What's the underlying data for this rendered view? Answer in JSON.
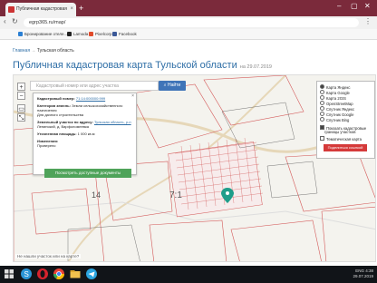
{
  "browser": {
    "tab_title": "Публичная кадастровая",
    "tab_close": "×",
    "new_tab": "+",
    "window_controls": [
      "–",
      "▢",
      "✕"
    ],
    "url": "egrp365.ru/map/",
    "bookmarks": [
      "Бронирование отеле...",
      "Lamoda",
      "Pixelcorp",
      "Facebook"
    ]
  },
  "page": {
    "breadcrumb_home": "Главная",
    "breadcrumb_sep": "→",
    "breadcrumb_current": "Тульская область",
    "title": "Публичная кадастровая карта Тульской области",
    "title_date": "на 29.07.2019"
  },
  "map": {
    "search_placeholder": "Кадастровый номер или адрес участка",
    "find_button": "Найти",
    "tools": [
      "+",
      "−",
      "▭",
      "⤡"
    ],
    "popup": {
      "close": "×",
      "cadastral_label": "Кадастровый номер:",
      "cadastral_value": "71:14:000000:999",
      "category_label": "Категория земель:",
      "category_value": "Земли сельскохозяйственного",
      "category_value2": "назначения",
      "use_value": "Для дачного строительства",
      "address_label": "Земельный участок по адресу:",
      "address_value": "Тульская область, р-н",
      "address_value2": "Ленинский, д. Варфоломеевка",
      "area_label": "Уточненная площадь:",
      "area_value": "1 000 кв.м",
      "note_label": "Изменения:",
      "note_value": "Проверено",
      "docs_button": "Посмотреть доступные документы"
    },
    "layers": [
      {
        "label": "Карта Яндекс",
        "checked": true
      },
      {
        "label": "Карта Google",
        "checked": false
      },
      {
        "label": "Карта 2GIS",
        "checked": false
      },
      {
        "label": "OpenStreetMap",
        "checked": false
      },
      {
        "label": "Спутник Яндекс",
        "checked": false
      },
      {
        "label": "Спутник Google",
        "checked": false
      },
      {
        "label": "Спутник Bing",
        "checked": false
      }
    ],
    "options": [
      {
        "label": "Показать кадастровые",
        "label2": "границы участков",
        "checked": true
      },
      {
        "label": "Тематическая карта",
        "checked": false
      }
    ],
    "share_button": "Поделиться ссылкой",
    "labels": [
      "14",
      "7:1"
    ],
    "status": "Не нашли участок или на карте?"
  },
  "taskbar": {
    "time": "4:38",
    "date": "29.07.2019",
    "lang": "ENG"
  },
  "colors": {
    "tabbar": "#7b2a3b",
    "accent_blue": "#3f74b8",
    "doc_green": "#4fa35a",
    "share_red": "#d53a3a",
    "parcel_red": "#d45a5a",
    "marker_teal": "#1f9e8a"
  }
}
